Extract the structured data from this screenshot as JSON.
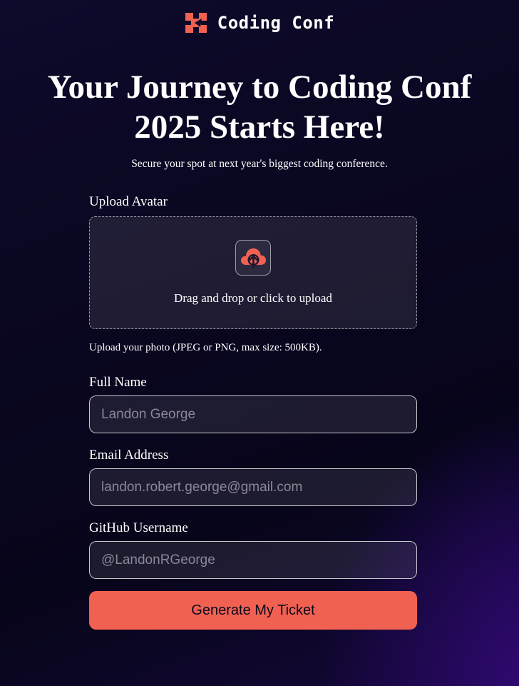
{
  "header": {
    "brand": "Coding Conf",
    "logo_icon": "coding-conf-logo-icon"
  },
  "hero": {
    "title": "Your Journey to Coding Conf 2025 Starts Here!",
    "subtitle": "Secure your spot at next year's biggest coding conference."
  },
  "upload": {
    "label": "Upload Avatar",
    "dropzone_text": "Drag and drop or click to upload",
    "icon": "cloud-upload-icon",
    "hint": "Upload your photo (JPEG or PNG, max size: 500KB)."
  },
  "fields": {
    "full_name": {
      "label": "Full Name",
      "placeholder": "Landon George"
    },
    "email": {
      "label": "Email Address",
      "placeholder": "landon.robert.george@gmail.com"
    },
    "github": {
      "label": "GitHub Username",
      "placeholder": "@LandonRGeorge"
    }
  },
  "submit_label": "Generate My Ticket",
  "colors": {
    "accent": "#f16152",
    "background": "#0d0a2b",
    "glow": "#340a78"
  }
}
